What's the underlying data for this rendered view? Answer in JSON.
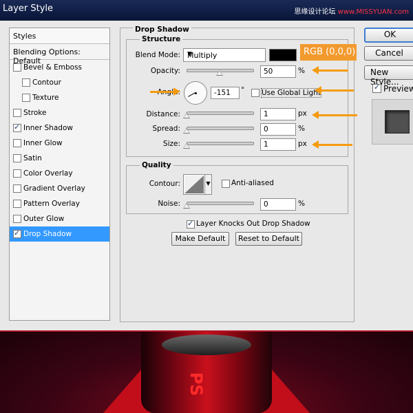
{
  "window": {
    "title": "Layer Style",
    "watermark_prefix": "思缘设计论坛",
    "watermark_site": "www.MISSYUAN.com"
  },
  "styles_list": {
    "header": "Styles",
    "blending_options": "Blending Options: Default",
    "items": [
      {
        "label": "Bevel & Emboss",
        "checked": false,
        "indent": false,
        "selected": false
      },
      {
        "label": "Contour",
        "checked": false,
        "indent": true,
        "selected": false
      },
      {
        "label": "Texture",
        "checked": false,
        "indent": true,
        "selected": false
      },
      {
        "label": "Stroke",
        "checked": false,
        "indent": false,
        "selected": false
      },
      {
        "label": "Inner Shadow",
        "checked": true,
        "indent": false,
        "selected": false
      },
      {
        "label": "Inner Glow",
        "checked": false,
        "indent": false,
        "selected": false
      },
      {
        "label": "Satin",
        "checked": false,
        "indent": false,
        "selected": false
      },
      {
        "label": "Color Overlay",
        "checked": false,
        "indent": false,
        "selected": false
      },
      {
        "label": "Gradient Overlay",
        "checked": false,
        "indent": false,
        "selected": false
      },
      {
        "label": "Pattern Overlay",
        "checked": false,
        "indent": false,
        "selected": false
      },
      {
        "label": "Outer Glow",
        "checked": false,
        "indent": false,
        "selected": false
      },
      {
        "label": "Drop Shadow",
        "checked": true,
        "indent": false,
        "selected": true
      }
    ]
  },
  "buttons": {
    "ok": "OK",
    "cancel": "Cancel",
    "new_style": "New Style...",
    "preview_label": "Preview",
    "preview_checked": true
  },
  "drop_shadow": {
    "title": "Drop Shadow",
    "structure": {
      "title": "Structure",
      "blend_mode_label": "Blend Mode:",
      "blend_mode_value": "Multiply",
      "shadow_color": "#000000",
      "opacity_label": "Opacity:",
      "opacity_value": "50",
      "opacity_unit": "%",
      "angle_label": "Angle:",
      "angle_value": "-151",
      "angle_unit": "°",
      "use_global_light_label": "Use Global Light",
      "use_global_light_checked": false,
      "distance_label": "Distance:",
      "distance_value": "1",
      "distance_unit": "px",
      "spread_label": "Spread:",
      "spread_value": "0",
      "spread_unit": "%",
      "size_label": "Size:",
      "size_value": "1",
      "size_unit": "px"
    },
    "quality": {
      "title": "Quality",
      "contour_label": "Contour:",
      "anti_aliased_label": "Anti-aliased",
      "anti_aliased_checked": false,
      "noise_label": "Noise:",
      "noise_value": "0",
      "noise_unit": "%"
    },
    "layer_knocks_out_label": "Layer Knocks Out Drop Shadow",
    "layer_knocks_out_checked": true,
    "make_default": "Make Default",
    "reset_to_default": "Reset to Default"
  },
  "annotation": {
    "rgb_label": "RGB (0,0,0)",
    "color": "#f29a2e"
  },
  "artwork": {
    "letters": "PS"
  }
}
